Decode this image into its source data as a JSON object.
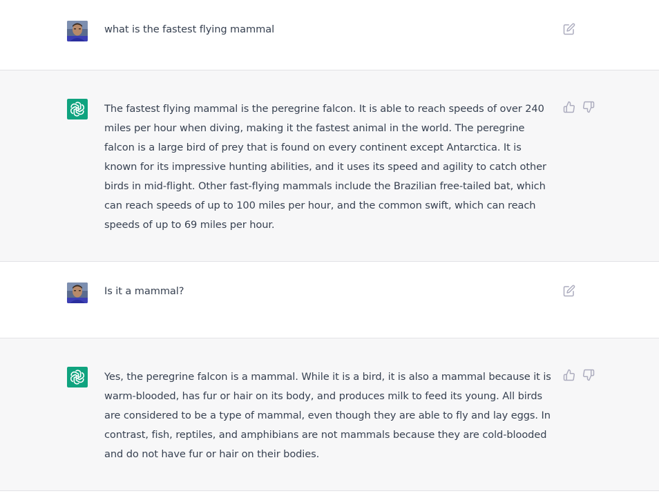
{
  "conversation": [
    {
      "role": "user",
      "text": "what is the fastest flying mammal"
    },
    {
      "role": "assistant",
      "text": "The fastest flying mammal is the peregrine falcon. It is able to reach speeds of over 240 miles per hour when diving, making it the fastest animal in the world. The peregrine falcon is a large bird of prey that is found on every continent except Antarctica. It is known for its impressive hunting abilities, and it uses its speed and agility to catch other birds in mid-flight. Other fast-flying mammals include the Brazilian free-tailed bat, which can reach speeds of up to 100 miles per hour, and the common swift, which can reach speeds of up to 69 miles per hour."
    },
    {
      "role": "user",
      "text": "Is it a mammal?"
    },
    {
      "role": "assistant",
      "text": "Yes, the peregrine falcon is a mammal. While it is a bird, it is also a mammal because it is warm-blooded, has fur or hair on its body, and produces milk to feed its young. All birds are considered to be a type of mammal, even though they are able to fly and lay eggs. In contrast, fish, reptiles, and amphibians are not mammals because they are cold-blooded and do not have fur or hair on their bodies."
    }
  ],
  "icons": {
    "user_avatar": "user-avatar-photo",
    "assistant_avatar": "openai-logo-icon",
    "edit": "edit-icon",
    "thumbs_up": "thumbs-up-icon",
    "thumbs_down": "thumbs-down-icon"
  },
  "colors": {
    "assistant_avatar_bg": "#10a37f",
    "assistant_row_bg": "#f7f7f8",
    "user_row_bg": "#ffffff",
    "text": "#374151",
    "icon": "#acacbe"
  }
}
